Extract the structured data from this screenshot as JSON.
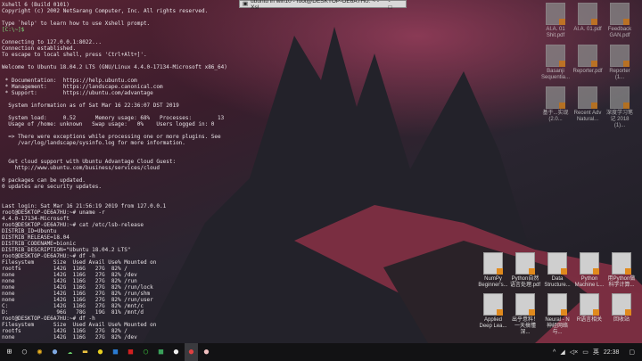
{
  "window": {
    "title": "ubuntu in win10 - root@DESKTOP-OE6A7HU: ~ - Xsl",
    "controls": "- □"
  },
  "terminal": {
    "lines": [
      "Xshell 6 (Build 0101)",
      "Copyright (c) 2002 NetSarang Computer, Inc. All rights reserved.",
      "",
      "Type `help' to learn how to use Xshell prompt.",
      "[C:\\~]$",
      "",
      "Connecting to 127.0.0.1:8022...",
      "Connection established.",
      "To escape to local shell, press 'Ctrl+Alt+]'.",
      "",
      "Welcome to Ubuntu 18.04.2 LTS (GNU/Linux 4.4.0-17134-Microsoft x86_64)",
      "",
      " * Documentation:  https://help.ubuntu.com",
      " * Management:     https://landscape.canonical.com",
      " * Support:        https://ubuntu.com/advantage",
      "",
      "  System information as of Sat Mar 16 22:36:07 DST 2019",
      "",
      "  System load:     0.52      Memory usage: 68%   Processes:        13",
      "  Usage of /home: unknown   Swap usage:   0%    Users logged in: 0",
      "",
      "  => There were exceptions while processing one or more plugins. See",
      "     /var/log/landscape/sysinfo.log for more information.",
      "",
      "",
      "  Get cloud support with Ubuntu Advantage Cloud Guest:",
      "    http://www.ubuntu.com/business/services/cloud",
      "",
      "0 packages can be updated.",
      "0 updates are security updates.",
      "",
      "",
      "Last login: Sat Mar 16 21:56:19 2019 from 127.0.0.1",
      "root@DESKTOP-OE6A7HU:~# uname -r",
      "4.4.0-17134-Microsoft",
      "root@DESKTOP-OE6A7HU:~# cat /etc/lsb-release",
      "DISTRIB_ID=Ubuntu",
      "DISTRIB_RELEASE=18.04",
      "DISTRIB_CODENAME=bionic",
      "DISTRIB_DESCRIPTION=\"Ubuntu 18.04.2 LTS\"",
      "root@DESKTOP-OE6A7HU:~# df -h",
      "Filesystem      Size  Used Avail Use% Mounted on",
      "rootfs          142G  116G   27G  82% /",
      "none            142G  116G   27G  82% /dev",
      "none            142G  116G   27G  82% /run",
      "none            142G  116G   27G  82% /run/lock",
      "none            142G  116G   27G  82% /run/shm",
      "none            142G  116G   27G  82% /run/user",
      "C:              142G  116G   27G  82% /mnt/c",
      "D:               96G   78G   19G  81% /mnt/d",
      "root@DESKTOP-OE6A7HU:~# df -h",
      "Filesystem      Size  Used Avail Use% Mounted on",
      "rootfs          142G  116G   27G  82% /",
      "none            142G  116G   27G  82% /dev"
    ]
  },
  "desktop_icons_top": [
    {
      "label": "AI.A. 01 Shit.pdf"
    },
    {
      "label": "AI.A. 01.pdf"
    },
    {
      "label": "Feedback GAN.pdf"
    },
    {
      "label": "Basanji Sequentia..."
    },
    {
      "label": "Reporter.pdf"
    },
    {
      "label": "Reporter (1..."
    },
    {
      "label": "基于...实现 (2.0..."
    },
    {
      "label": "Recent Adv Natural..."
    },
    {
      "label": "深度学习笔记 2018 (1)..."
    }
  ],
  "desktop_icons_bottom": [
    {
      "label": "NumPy Beginner's..."
    },
    {
      "label": "Python自然 语言处理.pdf"
    },
    {
      "label": "Data Structure..."
    },
    {
      "label": "Python Machine L..."
    },
    {
      "label": "用Python做 科学计算..."
    },
    {
      "label": "Applied Deep Lea..."
    },
    {
      "label": "出乎意料！ 一天搞懂深..."
    },
    {
      "label": "Neural - N 神经网络与..."
    },
    {
      "label": "R语言相关"
    },
    {
      "label": "回收站"
    }
  ],
  "taskbar": {
    "apps": [
      "windows-start",
      "cortana-search",
      "chrome",
      "app-blue",
      "wechat",
      "file-explorer",
      "app-yellow",
      "outlook",
      "adobe-reader",
      "app-green",
      "app-green2",
      "app-white",
      "xshell",
      "app-pink"
    ],
    "tray": {
      "chevron": "^",
      "ime": "英",
      "time": "22:38"
    }
  }
}
